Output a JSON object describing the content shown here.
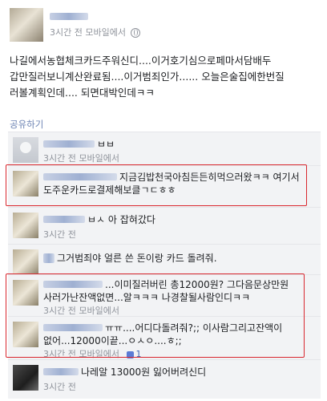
{
  "post": {
    "meta": "3시간 전 모바일에서",
    "lines": [
      "나길에서농협체크카드주워신디....이거호기심으로페마서담배두",
      "갑만질러보니계산완료됨....이거범죄인가...... 오늘은술집에한번질",
      "러볼계획인데.... 되면대박인데ㅋㅋ"
    ]
  },
  "share_label": "공유하기",
  "comments": [
    {
      "text": "ㅂㅂ",
      "meta": "3시간 전 모바일에서"
    },
    {
      "text_line1": "지금김밥천국아침든든히먹으러왔ㅋㅋ 여기서",
      "text_line2": "도주운카드로결제해보클ㄱㄷㅎㅎ",
      "meta": "3시간 전 모바일에서"
    },
    {
      "text": "ㅂㅅ 아 잡혀갔다",
      "meta": "3시간 전"
    },
    {
      "text": "그거범죄야 얼른 쓴 돈이랑 카드 돌려줘.",
      "meta": ""
    },
    {
      "text_line1": "...이미질러버린 총12000원? 그다음문상만원",
      "text_line2": "사러가난잔액없면...알ㅋㅋㅋ 나경찰될사람인디ㅋㅋ",
      "meta": "3시간 전 모바일에서"
    },
    {
      "text_line1": "ㅠㅠ....어디다돌려줘?;; 이사람그리고잔액이",
      "text_line2": "없어...12000이끝...ㅇㅅㅇ....ㅎ;;",
      "meta": "3시간 전 모바일에서",
      "likes": "1"
    },
    {
      "text": "나레알 13000원 잃어버려신디",
      "meta": "3시간 전"
    }
  ],
  "colors": {
    "highlight": "#d9272e",
    "meta": "#90949c",
    "link": "#4267b2"
  },
  "icons": {
    "privacy": "globe-icon",
    "like": "thumbs-up-icon"
  }
}
